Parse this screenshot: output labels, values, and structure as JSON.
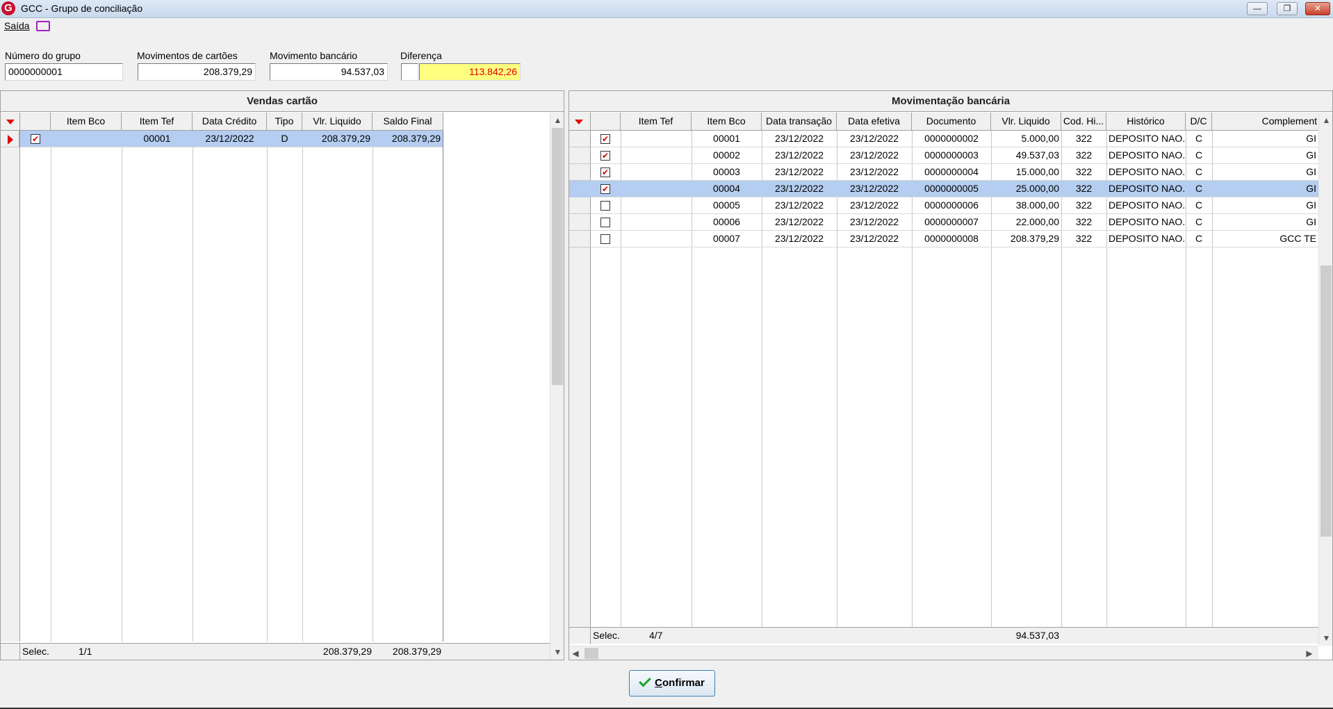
{
  "window": {
    "title": "GCC - Grupo de conciliação",
    "logo": "G",
    "minimize": "—",
    "restore": "❐",
    "close": "✕"
  },
  "menu": {
    "saida": "Saída"
  },
  "fields": {
    "numero_label": "Número do grupo",
    "numero_value": "0000000001",
    "cartoes_label": "Movimentos de cartões",
    "cartoes_value": "208.379,29",
    "bancario_label": "Movimento bancário",
    "bancario_value": "94.537,03",
    "diferenca_label": "Diferença",
    "diferenca_value": "113.842,26"
  },
  "left": {
    "title": "Vendas cartão",
    "headers": [
      "Item Bco",
      "Item Tef",
      "Data Crédito",
      "Tipo",
      "Vlr. Liquido",
      "Saldo Final"
    ],
    "rows": [
      {
        "item_bco": "",
        "item_tef": "00001",
        "data": "23/12/2022",
        "tipo": "D",
        "vlr": "208.379,29",
        "saldo": "208.379,29",
        "checked": "✔"
      }
    ],
    "footer": {
      "label": "Selec.",
      "count": "1/1",
      "vlr": "208.379,29",
      "saldo": "208.379,29"
    }
  },
  "right": {
    "title": "Movimentação bancária",
    "headers": [
      "Item Tef",
      "Item Bco",
      "Data transação",
      "Data efetiva",
      "Documento",
      "Vlr. Liquido",
      "Cod. Hi...",
      "Histórico",
      "D/C",
      "Complement"
    ],
    "rows": [
      {
        "item_bco": "00001",
        "dt": "23/12/2022",
        "de": "23/12/2022",
        "doc": "0000000002",
        "vlr": "5.000,00",
        "cod": "322",
        "hist": "DEPOSITO NAO...",
        "dc": "C",
        "comp": "GІ",
        "checked": "✔"
      },
      {
        "item_bco": "00002",
        "dt": "23/12/2022",
        "de": "23/12/2022",
        "doc": "0000000003",
        "vlr": "49.537,03",
        "cod": "322",
        "hist": "DEPOSITO NAO...",
        "dc": "C",
        "comp": "GІ",
        "checked": "✔"
      },
      {
        "item_bco": "00003",
        "dt": "23/12/2022",
        "de": "23/12/2022",
        "doc": "0000000004",
        "vlr": "15.000,00",
        "cod": "322",
        "hist": "DEPOSITO NAO...",
        "dc": "C",
        "comp": "GІ",
        "checked": "✔"
      },
      {
        "item_bco": "00004",
        "dt": "23/12/2022",
        "de": "23/12/2022",
        "doc": "0000000005",
        "vlr": "25.000,00",
        "cod": "322",
        "hist": "DEPOSITO NAO...",
        "dc": "C",
        "comp": "GІ",
        "checked": "✔"
      },
      {
        "item_bco": "00005",
        "dt": "23/12/2022",
        "de": "23/12/2022",
        "doc": "0000000006",
        "vlr": "38.000,00",
        "cod": "322",
        "hist": "DEPOSITO NAO...",
        "dc": "C",
        "comp": "GІ",
        "checked": ""
      },
      {
        "item_bco": "00006",
        "dt": "23/12/2022",
        "de": "23/12/2022",
        "doc": "0000000007",
        "vlr": "22.000,00",
        "cod": "322",
        "hist": "DEPOSITO NAO...",
        "dc": "C",
        "comp": "GІ",
        "checked": ""
      },
      {
        "item_bco": "00007",
        "dt": "23/12/2022",
        "de": "23/12/2022",
        "doc": "0000000008",
        "vlr": "208.379,29",
        "cod": "322",
        "hist": "DEPOSITO NAO...",
        "dc": "C",
        "comp": "GCC TE",
        "checked": ""
      }
    ],
    "footer": {
      "label": "Selec.",
      "count": "4/7",
      "vlr": "94.537,03"
    }
  },
  "confirm": {
    "prefix": "",
    "underline": "C",
    "rest": "onfirmar"
  },
  "colors": {
    "selection": "#b4cdf0",
    "difference_bg": "#ffff80",
    "difference_text": "#e00000",
    "pointer": "#e00000"
  },
  "icons": [
    "app-logo-icon",
    "monitor-icon",
    "checkmark-icon",
    "row-pointer-icon",
    "sort-arrow-icon"
  ]
}
